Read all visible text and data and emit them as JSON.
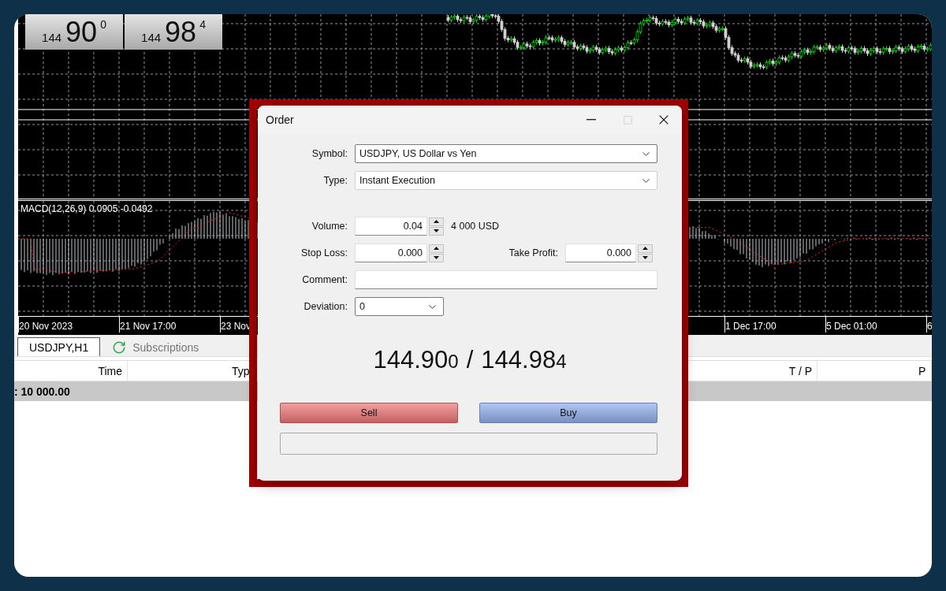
{
  "quotes": [
    {
      "big_figure": "144",
      "pips": "90",
      "point": "0"
    },
    {
      "big_figure": "144",
      "pips": "98",
      "point": "4"
    }
  ],
  "chart": {
    "indicator_label": "MACD(12,26,9) 0.0905 -0.0492",
    "time_labels": [
      "20 Nov 2023",
      "21 Nov 17:00",
      "23 Nov",
      "1 Dec 17:00",
      "5 Dec 01:00",
      "6"
    ]
  },
  "tabs": [
    {
      "label": "USDJPY,H1",
      "selected": true,
      "kind": "chart"
    },
    {
      "label": "Subscriptions",
      "selected": false,
      "kind": "refresh"
    }
  ],
  "table": {
    "columns": [
      "Time",
      "Typ",
      "T / P",
      "P"
    ],
    "balance": ": 10 000.00"
  },
  "dialog": {
    "title": "Order",
    "maximize_disabled": true,
    "symbol": {
      "label": "Symbol:",
      "value": "USDJPY, US Dollar vs Yen"
    },
    "type": {
      "label": "Type:",
      "value": "Instant Execution"
    },
    "volume": {
      "label": "Volume:",
      "value": "0.04",
      "note": "4 000 USD"
    },
    "stop_loss": {
      "label": "Stop Loss:",
      "value": "0.000"
    },
    "take_profit": {
      "label": "Take Profit:",
      "value": "0.000"
    },
    "comment": {
      "label": "Comment:"
    },
    "deviation": {
      "label": "Deviation:",
      "value": "0"
    },
    "price": {
      "bid": "144.90",
      "bid_point": "0",
      "separator": "/",
      "ask": "144.98",
      "ask_point": "4"
    },
    "buttons": [
      {
        "label": "Sell",
        "kind": "sell"
      },
      {
        "label": "Buy",
        "kind": "buy"
      }
    ]
  }
}
